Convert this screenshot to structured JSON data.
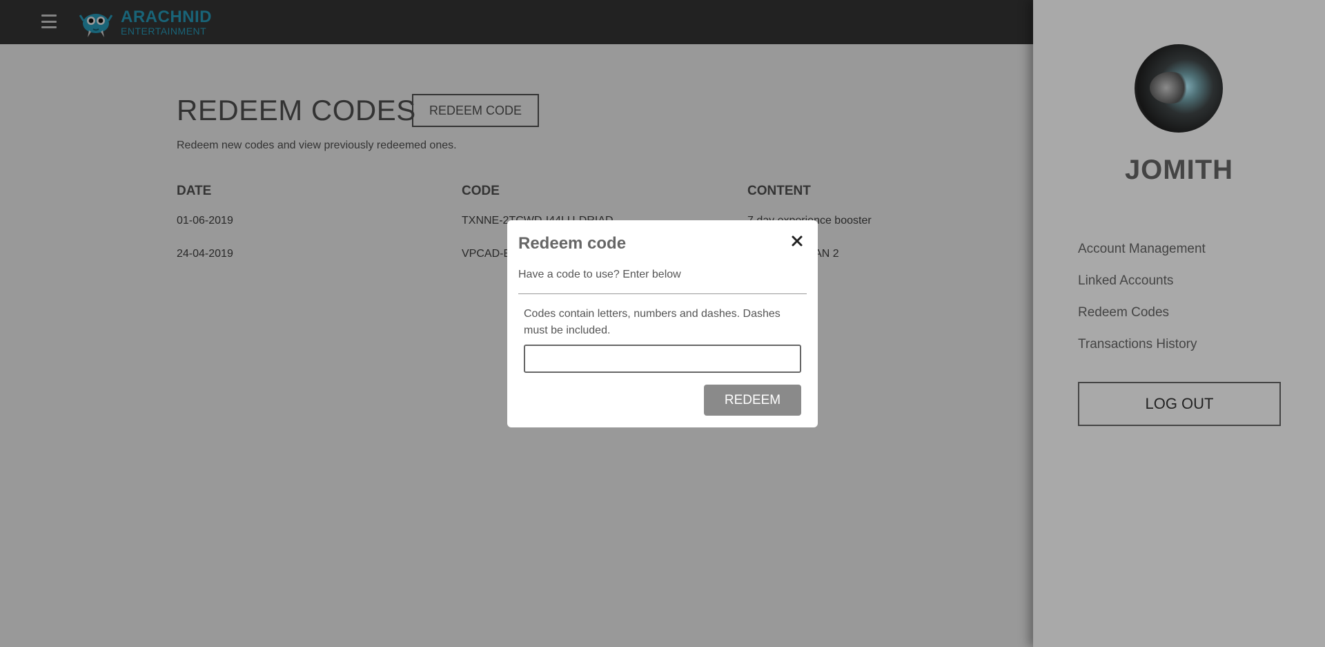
{
  "brand": {
    "title": "ARACHNID",
    "subtitle": "ENTERTAINMENT"
  },
  "page": {
    "title": "REDEEM CODES",
    "redeem_button": "REDEEM CODE",
    "subtitle": "Redeem new codes and view previously redeemed ones."
  },
  "table": {
    "headers": [
      "DATE",
      "CODE",
      "CONTENT"
    ],
    "rows": [
      [
        "01-06-2019",
        "TXNNE-2TCWD-I44LU-DRIAD",
        "7 day experience booster"
      ],
      [
        "24-04-2019",
        "VPCAD-E",
        "HITMAN 2"
      ]
    ]
  },
  "modal": {
    "title": "Redeem code",
    "description": "Have a code to use? Enter below",
    "hint": "Codes contain letters, numbers and dashes. Dashes must be included.",
    "input_value": "",
    "submit_label": "REDEEM"
  },
  "sidebar": {
    "username": "JOMITH",
    "links": [
      "Account Management",
      "Linked Accounts",
      "Redeem Codes",
      "Transactions History"
    ],
    "logout_label": "LOG OUT"
  },
  "colors": {
    "topbar": "#393939",
    "brand_accent": "#2aa7c9",
    "sidebar_bg": "#a9a9a9",
    "overlay": "rgba(0,0,0,0.4)",
    "redeem_button_bg": "#8a8a8a"
  },
  "icons": {
    "menu": "hamburger-icon",
    "logo": "spider-logo-icon",
    "close": "close-icon"
  }
}
